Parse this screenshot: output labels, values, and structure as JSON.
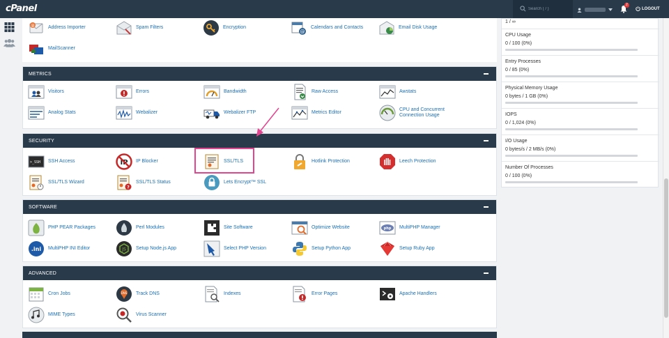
{
  "brand": {
    "logo_text": "cPanel"
  },
  "header": {
    "search_placeholder": "Search ( / )",
    "notification_count": "2",
    "logout_label": "LOGOUT"
  },
  "pre_section_items": [
    {
      "label": "Address Importer",
      "icon": "address-importer-icon"
    },
    {
      "label": "Spam Filters",
      "icon": "spam-filters-icon"
    },
    {
      "label": "Encryption",
      "icon": "encryption-icon"
    },
    {
      "label": "Calendars and Contacts",
      "icon": "calendars-contacts-icon"
    },
    {
      "label": "Email Disk Usage",
      "icon": "email-disk-usage-icon"
    },
    {
      "label": "MailScanner",
      "icon": "mailscanner-icon"
    }
  ],
  "sections": {
    "metrics": {
      "title": "METRICS",
      "items": [
        {
          "label": "Visitors"
        },
        {
          "label": "Errors"
        },
        {
          "label": "Bandwidth"
        },
        {
          "label": "Raw Access"
        },
        {
          "label": "Awstats"
        },
        {
          "label": "Analog Stats"
        },
        {
          "label": "Webalizer"
        },
        {
          "label": "Webalizer FTP"
        },
        {
          "label": "Metrics Editor"
        },
        {
          "label": "CPU and Concurrent",
          "label2": "Connection Usage"
        }
      ]
    },
    "security": {
      "title": "SECURITY",
      "items": [
        {
          "label": "SSH Access"
        },
        {
          "label": "IP Blocker"
        },
        {
          "label": "SSL/TLS"
        },
        {
          "label": "Hotlink Protection"
        },
        {
          "label": "Leech Protection"
        },
        {
          "label": "SSL/TLS Wizard"
        },
        {
          "label": "SSL/TLS Status"
        },
        {
          "label": "Lets Encrypt™ SSL"
        }
      ]
    },
    "software": {
      "title": "SOFTWARE",
      "items": [
        {
          "label": "PHP PEAR Packages"
        },
        {
          "label": "Perl Modules"
        },
        {
          "label": "Site Software"
        },
        {
          "label": "Optimize Website"
        },
        {
          "label": "MultiPHP Manager"
        },
        {
          "label": "MultiPHP INI Editor"
        },
        {
          "label": "Setup Node.js App"
        },
        {
          "label": "Select PHP Version"
        },
        {
          "label": "Setup Python App"
        },
        {
          "label": "Setup Ruby App"
        }
      ]
    },
    "advanced": {
      "title": "ADVANCED",
      "items": [
        {
          "label": "Cron Jobs"
        },
        {
          "label": "Track DNS"
        },
        {
          "label": "Indexes"
        },
        {
          "label": "Error Pages"
        },
        {
          "label": "Apache Handlers"
        },
        {
          "label": "MIME Types"
        },
        {
          "label": "Virus Scanner"
        }
      ]
    }
  },
  "stats": [
    {
      "label": "",
      "value": "1 / ∞",
      "fraction": 0
    },
    {
      "label": "CPU Usage",
      "value": "0 / 100   (0%)",
      "fraction": 0
    },
    {
      "label": "Entry Processes",
      "value": "0 / 85   (0%)",
      "fraction": 0
    },
    {
      "label": "Physical Memory Usage",
      "value": "0 bytes / 1 GB   (0%)",
      "fraction": 0
    },
    {
      "label": "IOPS",
      "value": "0 / 1,024   (0%)",
      "fraction": 0
    },
    {
      "label": "I/O Usage",
      "value": "0 bytes/s / 2 MB/s   (0%)",
      "fraction": 0
    },
    {
      "label": "Number Of Processes",
      "value": "0 / 100   (0%)",
      "fraction": 0
    }
  ],
  "colors": {
    "header_bg": "#293a4a",
    "link": "#1a6fb5",
    "highlight": "#e2448f"
  }
}
